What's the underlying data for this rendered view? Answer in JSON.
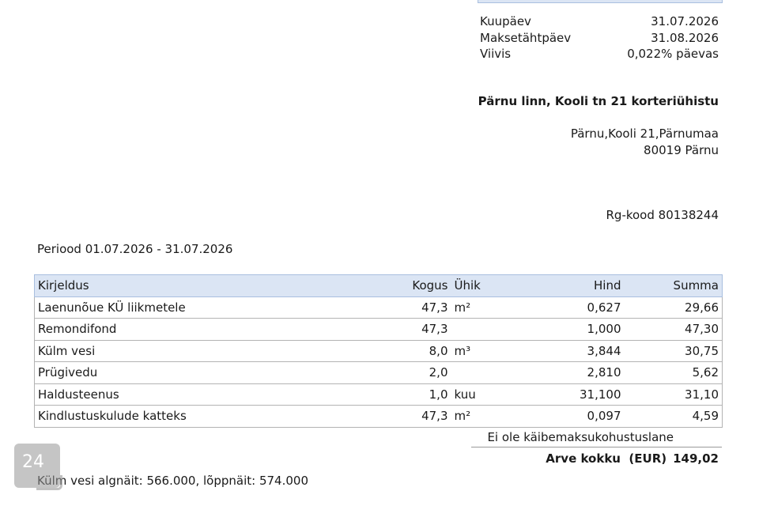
{
  "invoice_meta": [
    {
      "label": "Kuupäev",
      "value": "31.07.2026"
    },
    {
      "label": "Maksetähtpäev",
      "value": "31.08.2026"
    },
    {
      "label": "Viivis",
      "value": "0,022% päevas"
    }
  ],
  "recipient": {
    "name": "Pärnu linn, Kooli tn 21 korteriühistu",
    "address_line1": "Pärnu,Kooli 21,Pärnumaa",
    "address_line2": "80019 Pärnu",
    "reg_code": "Rg-kood 80138244"
  },
  "period": "Periood 01.07.2026 - 31.07.2026",
  "table": {
    "headers": {
      "description": "Kirjeldus",
      "quantity": "Kogus",
      "unit": "Ühik",
      "price": "Hind",
      "sum": "Summa"
    },
    "rows": [
      {
        "description": "Laenunõue KÜ liikmetele",
        "quantity": "47,3",
        "unit": "m²",
        "price": "0,627",
        "sum": "29,66"
      },
      {
        "description": "Remondifond",
        "quantity": "47,3",
        "unit": "",
        "price": "1,000",
        "sum": "47,30"
      },
      {
        "description": "Külm vesi",
        "quantity": "8,0",
        "unit": "m³",
        "price": "3,844",
        "sum": "30,75"
      },
      {
        "description": "Prügivedu",
        "quantity": "2,0",
        "unit": "",
        "price": "2,810",
        "sum": "5,62"
      },
      {
        "description": "Haldusteenus",
        "quantity": "1,0",
        "unit": "kuu",
        "price": "31,100",
        "sum": "31,10"
      },
      {
        "description": "Kindlustuskulude katteks",
        "quantity": "47,3",
        "unit": "m²",
        "price": "0,097",
        "sum": "4,59"
      }
    ]
  },
  "vat_note": "Ei ole käibemaksukohustuslane",
  "total": {
    "label": "Arve kokku  (EUR)",
    "value": "149,02"
  },
  "meter_note": "Külm vesi algnäit: 566.000, lõppnäit: 574.000",
  "badge": {
    "text": "24"
  },
  "colors": {
    "header_fill": "#dbe5f4",
    "header_border": "#a9bfdf"
  }
}
